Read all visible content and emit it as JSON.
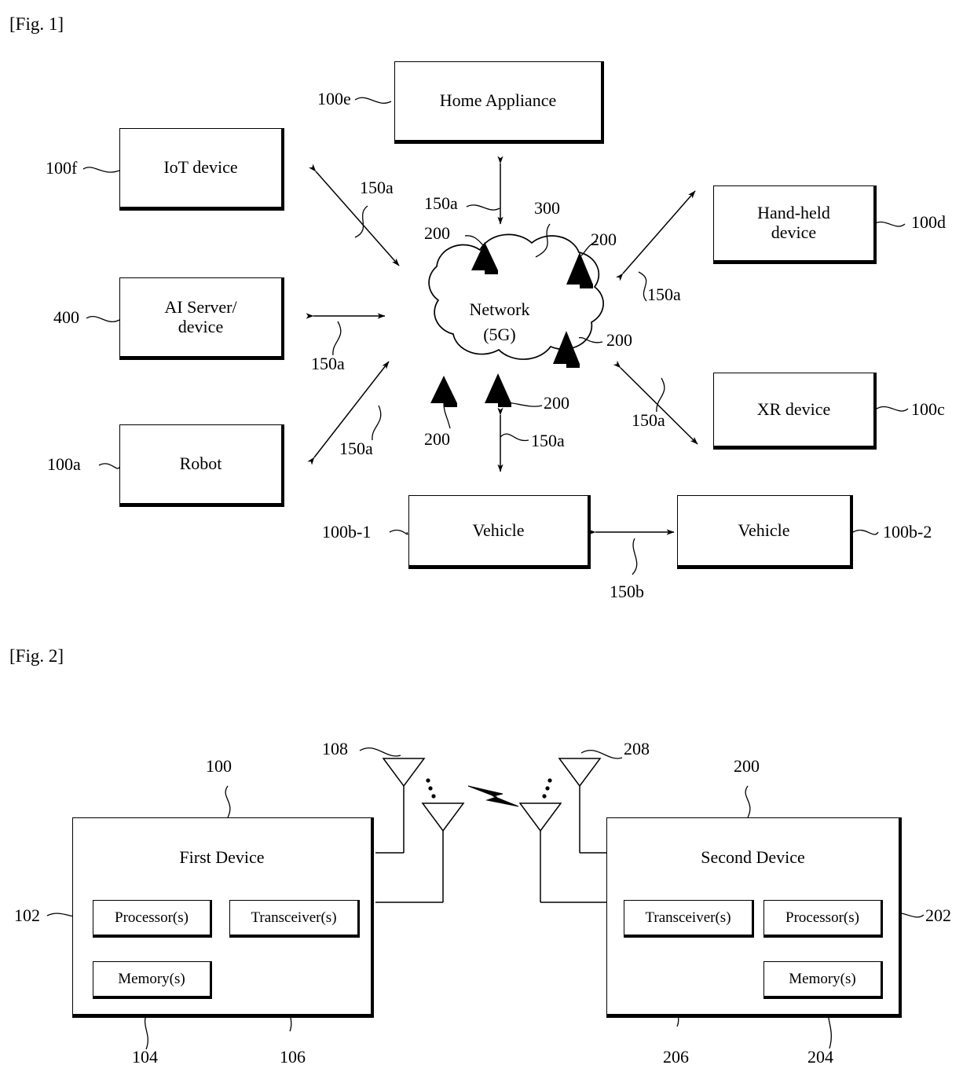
{
  "figures": [
    {
      "label": "[Fig. 1]"
    },
    {
      "label": "[Fig. 2]"
    }
  ],
  "fig1": {
    "label": "[Fig. 1]",
    "boxes": [
      {
        "name": "home-appliance",
        "text": "Home Appliance",
        "ref": "100e"
      },
      {
        "name": "iot-device",
        "text": "IoT device",
        "ref": "100f"
      },
      {
        "name": "ai-server",
        "text": "AI Server/\ndevice",
        "ref": "400"
      },
      {
        "name": "robot",
        "text": "Robot",
        "ref": "100a"
      },
      {
        "name": "hand-held-device",
        "text": "Hand-held\ndevice",
        "ref": "100d"
      },
      {
        "name": "xr-device",
        "text": "XR device",
        "ref": "100c"
      },
      {
        "name": "vehicle-left",
        "text": "Vehicle",
        "ref": "100b-1"
      },
      {
        "name": "vehicle-right",
        "text": "Vehicle",
        "ref": "100b-2"
      }
    ],
    "cloud": {
      "text": "Network\n(5G)",
      "ref": "300"
    },
    "base_station_ref": "200",
    "base_station_count": 5,
    "link_ref_wireless": "150a",
    "link_ref_sidelink": "150b",
    "link_labels_150a": [
      "150a",
      "150a",
      "150a",
      "150a",
      "150a",
      "150a",
      "150a"
    ],
    "antenna_labels_200": [
      "200",
      "200",
      "200",
      "200",
      "200"
    ]
  },
  "fig2": {
    "label": "[Fig. 2]",
    "first_device": {
      "title": "First Device",
      "ref": "100",
      "antenna_ref": "108",
      "modules": [
        {
          "name": "processor",
          "text": "Processor(s)",
          "ref": "102"
        },
        {
          "name": "transceiver",
          "text": "Transceiver(s)",
          "ref": "106"
        },
        {
          "name": "memory",
          "text": "Memory(s)",
          "ref": "104"
        }
      ]
    },
    "second_device": {
      "title": "Second Device",
      "ref": "200",
      "antenna_ref": "208",
      "modules": [
        {
          "name": "transceiver",
          "text": "Transceiver(s)",
          "ref": "206"
        },
        {
          "name": "processor",
          "text": "Processor(s)",
          "ref": "202"
        },
        {
          "name": "memory",
          "text": "Memory(s)",
          "ref": "204"
        }
      ]
    },
    "wireless_link_icon": "lightning-bolt-icon",
    "ellipsis_icon": "vertical-dots-icon"
  },
  "colors": {
    "ink": "#000000",
    "paper": "#ffffff"
  }
}
